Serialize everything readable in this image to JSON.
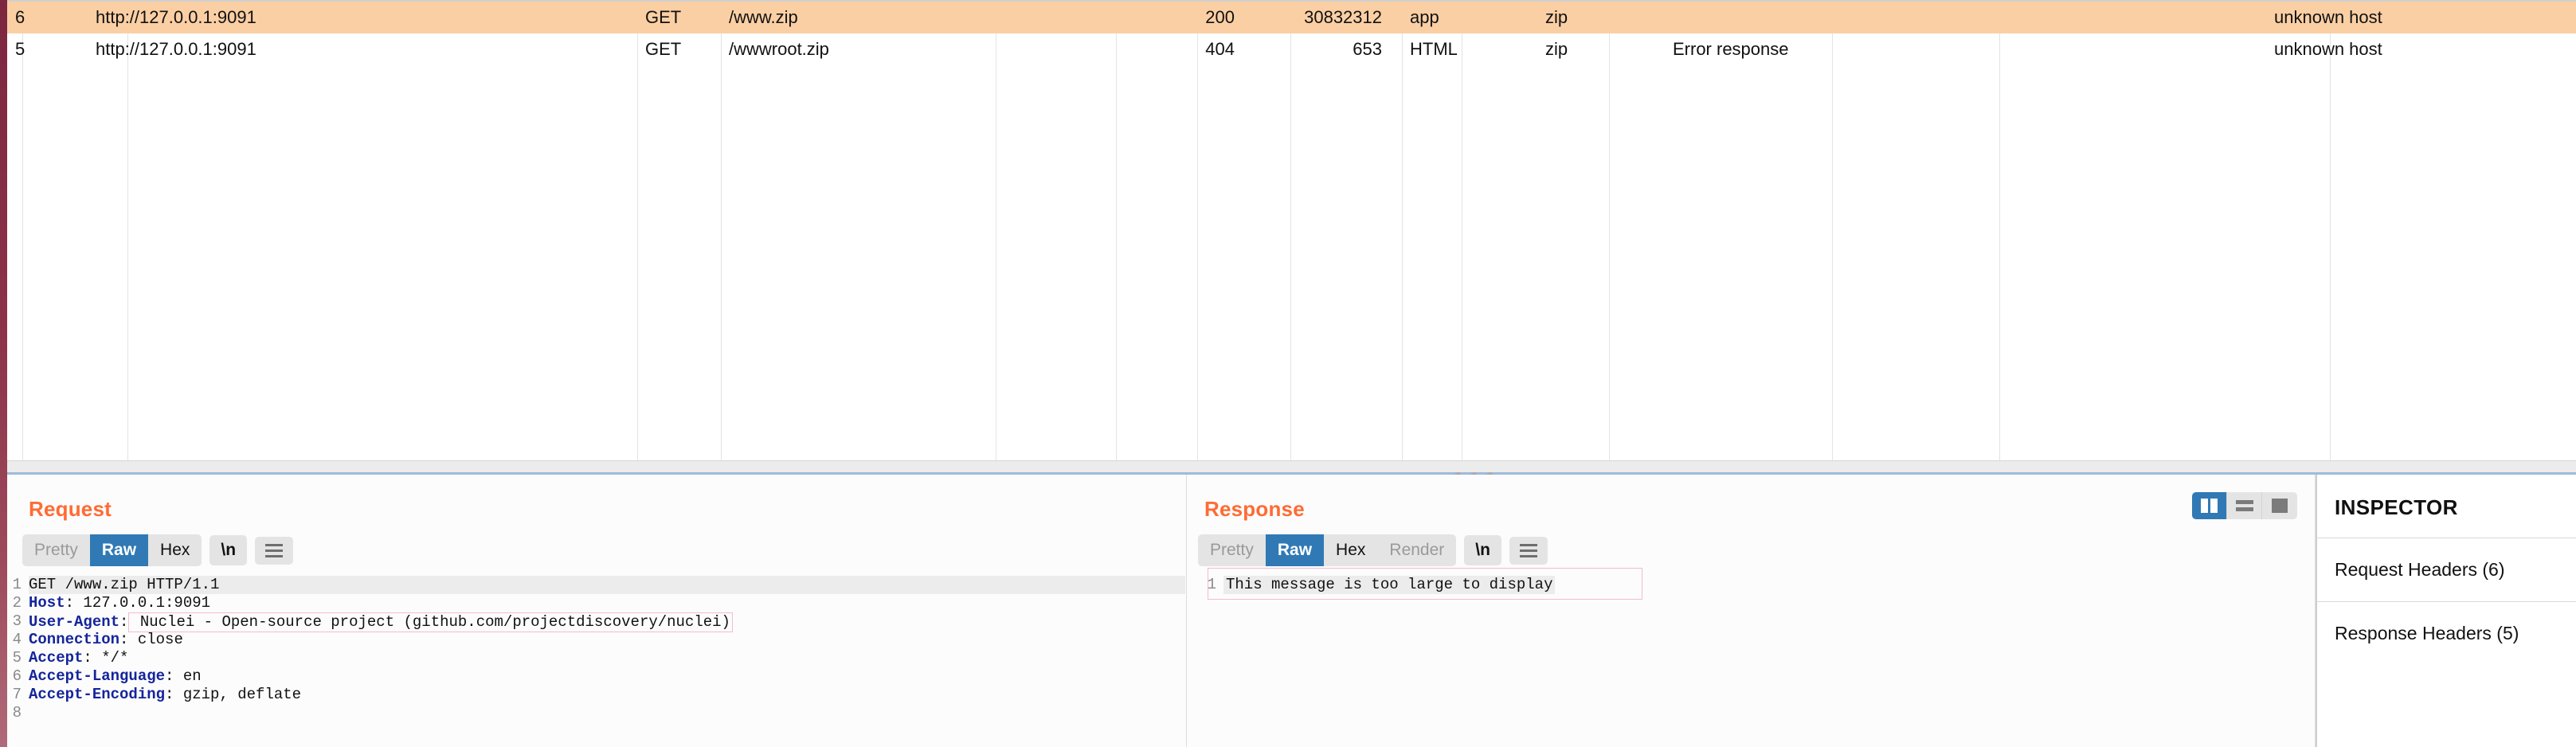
{
  "table": {
    "column_x": [
      28,
      160,
      800,
      905,
      1250,
      1401,
      1503,
      1620,
      1760,
      1835,
      2020,
      2300,
      2510,
      2925
    ],
    "rows": [
      {
        "id": "6",
        "host": "http://127.0.0.1:9091",
        "method": "GET",
        "path": "/www.zip",
        "params": "",
        "status": "200",
        "length": "30832312",
        "mime": "app",
        "extension": "zip",
        "title": "",
        "notes": "",
        "tls": "",
        "ip": "unknown host",
        "selected": true
      },
      {
        "id": "5",
        "host": "http://127.0.0.1:9091",
        "method": "GET",
        "path": "/wwwroot.zip",
        "params": "",
        "status": "404",
        "length": "653",
        "mime": "HTML",
        "extension": "zip",
        "title": "Error response",
        "notes": "",
        "tls": "",
        "ip": "unknown host",
        "selected": false
      }
    ]
  },
  "request": {
    "title": "Request",
    "tabs": [
      {
        "label": "Pretty",
        "state": "muted"
      },
      {
        "label": "Raw",
        "state": "active"
      },
      {
        "label": "Hex",
        "state": "normal"
      }
    ],
    "newline_label": "\\n",
    "menu_icon": "hamburger-icon",
    "lines": [
      {
        "n": "1",
        "text": "GET /www.zip HTTP/1.1",
        "kind": "startline"
      },
      {
        "n": "2",
        "name": "Host",
        "value": " 127.0.0.1:9091",
        "kind": "header"
      },
      {
        "n": "3",
        "name": "User-Agent",
        "value": " Nuclei - Open-source project (github.com/projectdiscovery/nuclei)",
        "kind": "header-boxed"
      },
      {
        "n": "4",
        "name": "Connection",
        "value": " close",
        "kind": "header"
      },
      {
        "n": "5",
        "name": "Accept",
        "value": " */*",
        "kind": "header"
      },
      {
        "n": "6",
        "name": "Accept-Language",
        "value": " en",
        "kind": "header"
      },
      {
        "n": "7",
        "name": "Accept-Encoding",
        "value": " gzip, deflate",
        "kind": "header"
      },
      {
        "n": "8",
        "text": "",
        "kind": "blank"
      }
    ]
  },
  "response": {
    "title": "Response",
    "tabs": [
      {
        "label": "Pretty",
        "state": "muted"
      },
      {
        "label": "Raw",
        "state": "active"
      },
      {
        "label": "Hex",
        "state": "normal"
      },
      {
        "label": "Render",
        "state": "muted"
      }
    ],
    "newline_label": "\\n",
    "menu_icon": "hamburger-icon",
    "lines": [
      {
        "n": "1",
        "text": "This message is too large to display",
        "kind": "message"
      }
    ]
  },
  "view_modes": [
    {
      "icon": "split-vertical-icon",
      "active": true
    },
    {
      "icon": "split-horizontal-icon",
      "active": false
    },
    {
      "icon": "single-pane-icon",
      "active": false
    }
  ],
  "inspector": {
    "title": "INSPECTOR",
    "sections": [
      {
        "label": "Request Headers (6)"
      },
      {
        "label": "Response Headers (5)"
      }
    ]
  },
  "colors": {
    "accent_orange": "#ff6b33",
    "selected_row": "#fbcfa4",
    "active_tab_blue": "#3079b5",
    "header_name_blue": "#14259b",
    "splitter_blue": "#9dbbdc",
    "stripe_maroon": "#8c3349",
    "highlight_pink_border": "#f3bccb"
  }
}
